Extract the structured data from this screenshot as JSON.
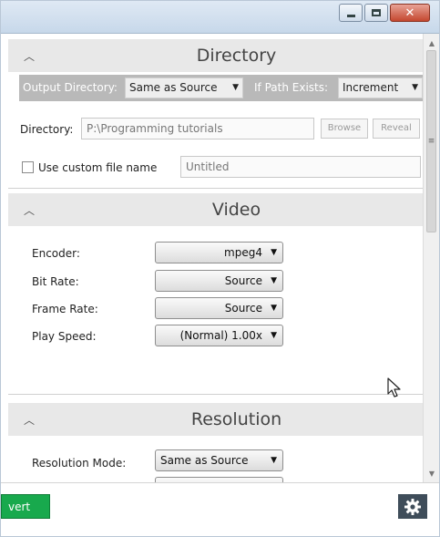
{
  "directory": {
    "title": "Directory",
    "output_dir_label": "Output Directory:",
    "output_dir_value": "Same as Source",
    "if_path_exists_label": "If Path Exists:",
    "if_path_exists_value": "Increment",
    "directory_label": "Directory:",
    "directory_value": "P:\\Programming tutorials",
    "browse_label": "Browse",
    "reveal_label": "Reveal",
    "custom_name_label": "Use custom file name",
    "custom_name_placeholder": "Untitled",
    "custom_name_checked": false
  },
  "video": {
    "title": "Video",
    "rows": [
      {
        "label": "Encoder:",
        "value": "mpeg4"
      },
      {
        "label": "Bit Rate:",
        "value": "Source"
      },
      {
        "label": "Frame Rate:",
        "value": "Source"
      },
      {
        "label": "Play Speed:",
        "value": "(Normal) 1.00x"
      }
    ]
  },
  "resolution": {
    "title": "Resolution",
    "mode_label": "Resolution Mode:",
    "mode_value": "Same as Source"
  },
  "footer": {
    "convert_label": "vert"
  },
  "icons": {
    "section_toggle": "chevron-up-icon",
    "dropdown": "triangle-down-icon",
    "settings": "gear-icon",
    "close": "close-icon"
  },
  "colors": {
    "convert_button": "#18a94d",
    "settings_button": "#3f4d5a",
    "section_header": "#e8e8e8",
    "directory_bar": "#b9b9b9"
  }
}
